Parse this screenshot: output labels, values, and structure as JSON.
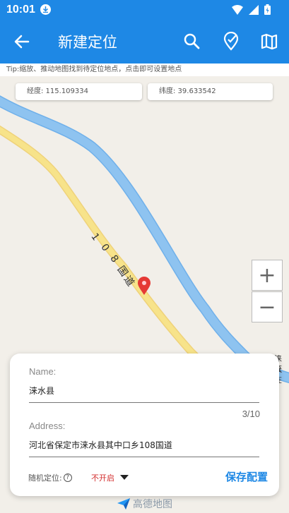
{
  "status_bar": {
    "time": "10:01"
  },
  "app_bar": {
    "title": "新建定位",
    "back_icon": "arrow-left-icon",
    "actions": [
      "search-icon",
      "location-check-icon",
      "map-icon"
    ]
  },
  "tip": "Tip:缩放、推动地图找到待定位地点，点击即可设置地点",
  "coords": {
    "longitude": "经度:  115.109334",
    "latitude": "纬度:  39.633542"
  },
  "map": {
    "road_label": [
      "1",
      "0",
      "8",
      "国",
      "道"
    ],
    "edge_label": [
      "涞水",
      "鉴在"
    ],
    "zoom_in": "+",
    "zoom_out": "−"
  },
  "form": {
    "name_label": "Name:",
    "name_value": "涞水县",
    "name_counter": "3/10",
    "address_label": "Address:",
    "address_value": "河北省保定市涞水县其中口乡108国道",
    "random_label": "随机定位:",
    "help_glyph": "?",
    "random_status": "不开启",
    "save_label": "保存配置"
  },
  "branding": {
    "text": "高德地图"
  },
  "colors": {
    "primary": "#1e88e5",
    "road_highway": "#f7e38a",
    "river": "#8ec3f0",
    "status_red": "#d32f2f"
  }
}
